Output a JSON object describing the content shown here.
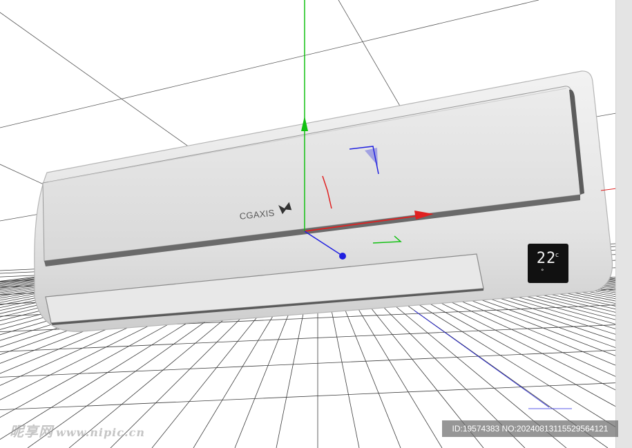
{
  "viewport": {
    "scene": "3d-modeling-viewport",
    "colors": {
      "background": "#ffffff",
      "grid_line": "#3a3a3a",
      "unit_body": "#e6e6e6",
      "axis_x": "#e02020",
      "axis_y": "#10c010",
      "axis_z": "#2020e0",
      "display_background": "#111111",
      "display_text": "#f2f2f2"
    },
    "gizmo": {
      "axes": [
        "x-axis",
        "y-axis",
        "z-axis"
      ],
      "icons": [
        "move-gizmo-icon",
        "rotate-handle-icon"
      ]
    }
  },
  "model": {
    "brand_label": "CGAXIS",
    "logo_icon": "cgaxis-logo-icon",
    "display": {
      "temperature": "22",
      "unit": "c",
      "degree_mark": "°"
    }
  },
  "watermark": {
    "site_text": "昵享网",
    "site_url": "www.nipic.cn",
    "id_stamp": "ID:19574383 NO:20240813115529564121"
  }
}
